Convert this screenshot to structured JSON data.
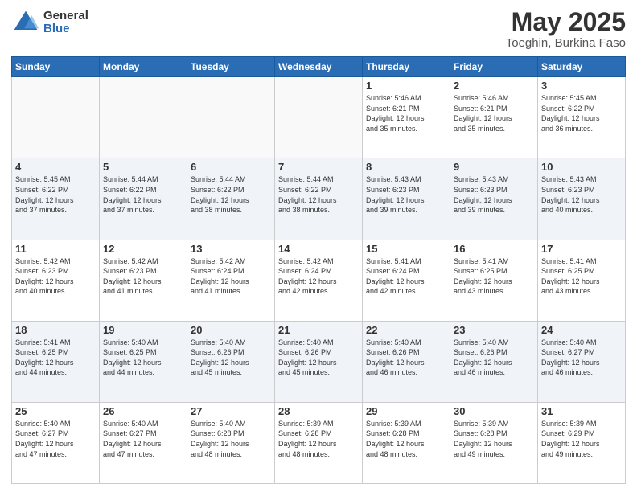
{
  "header": {
    "logo_general": "General",
    "logo_blue": "Blue",
    "title": "May 2025",
    "subtitle": "Toeghin, Burkina Faso"
  },
  "days_of_week": [
    "Sunday",
    "Monday",
    "Tuesday",
    "Wednesday",
    "Thursday",
    "Friday",
    "Saturday"
  ],
  "weeks": [
    [
      {
        "day": "",
        "info": ""
      },
      {
        "day": "",
        "info": ""
      },
      {
        "day": "",
        "info": ""
      },
      {
        "day": "",
        "info": ""
      },
      {
        "day": "1",
        "info": "Sunrise: 5:46 AM\nSunset: 6:21 PM\nDaylight: 12 hours\nand 35 minutes."
      },
      {
        "day": "2",
        "info": "Sunrise: 5:46 AM\nSunset: 6:21 PM\nDaylight: 12 hours\nand 35 minutes."
      },
      {
        "day": "3",
        "info": "Sunrise: 5:45 AM\nSunset: 6:22 PM\nDaylight: 12 hours\nand 36 minutes."
      }
    ],
    [
      {
        "day": "4",
        "info": "Sunrise: 5:45 AM\nSunset: 6:22 PM\nDaylight: 12 hours\nand 37 minutes."
      },
      {
        "day": "5",
        "info": "Sunrise: 5:44 AM\nSunset: 6:22 PM\nDaylight: 12 hours\nand 37 minutes."
      },
      {
        "day": "6",
        "info": "Sunrise: 5:44 AM\nSunset: 6:22 PM\nDaylight: 12 hours\nand 38 minutes."
      },
      {
        "day": "7",
        "info": "Sunrise: 5:44 AM\nSunset: 6:22 PM\nDaylight: 12 hours\nand 38 minutes."
      },
      {
        "day": "8",
        "info": "Sunrise: 5:43 AM\nSunset: 6:23 PM\nDaylight: 12 hours\nand 39 minutes."
      },
      {
        "day": "9",
        "info": "Sunrise: 5:43 AM\nSunset: 6:23 PM\nDaylight: 12 hours\nand 39 minutes."
      },
      {
        "day": "10",
        "info": "Sunrise: 5:43 AM\nSunset: 6:23 PM\nDaylight: 12 hours\nand 40 minutes."
      }
    ],
    [
      {
        "day": "11",
        "info": "Sunrise: 5:42 AM\nSunset: 6:23 PM\nDaylight: 12 hours\nand 40 minutes."
      },
      {
        "day": "12",
        "info": "Sunrise: 5:42 AM\nSunset: 6:23 PM\nDaylight: 12 hours\nand 41 minutes."
      },
      {
        "day": "13",
        "info": "Sunrise: 5:42 AM\nSunset: 6:24 PM\nDaylight: 12 hours\nand 41 minutes."
      },
      {
        "day": "14",
        "info": "Sunrise: 5:42 AM\nSunset: 6:24 PM\nDaylight: 12 hours\nand 42 minutes."
      },
      {
        "day": "15",
        "info": "Sunrise: 5:41 AM\nSunset: 6:24 PM\nDaylight: 12 hours\nand 42 minutes."
      },
      {
        "day": "16",
        "info": "Sunrise: 5:41 AM\nSunset: 6:25 PM\nDaylight: 12 hours\nand 43 minutes."
      },
      {
        "day": "17",
        "info": "Sunrise: 5:41 AM\nSunset: 6:25 PM\nDaylight: 12 hours\nand 43 minutes."
      }
    ],
    [
      {
        "day": "18",
        "info": "Sunrise: 5:41 AM\nSunset: 6:25 PM\nDaylight: 12 hours\nand 44 minutes."
      },
      {
        "day": "19",
        "info": "Sunrise: 5:40 AM\nSunset: 6:25 PM\nDaylight: 12 hours\nand 44 minutes."
      },
      {
        "day": "20",
        "info": "Sunrise: 5:40 AM\nSunset: 6:26 PM\nDaylight: 12 hours\nand 45 minutes."
      },
      {
        "day": "21",
        "info": "Sunrise: 5:40 AM\nSunset: 6:26 PM\nDaylight: 12 hours\nand 45 minutes."
      },
      {
        "day": "22",
        "info": "Sunrise: 5:40 AM\nSunset: 6:26 PM\nDaylight: 12 hours\nand 46 minutes."
      },
      {
        "day": "23",
        "info": "Sunrise: 5:40 AM\nSunset: 6:26 PM\nDaylight: 12 hours\nand 46 minutes."
      },
      {
        "day": "24",
        "info": "Sunrise: 5:40 AM\nSunset: 6:27 PM\nDaylight: 12 hours\nand 46 minutes."
      }
    ],
    [
      {
        "day": "25",
        "info": "Sunrise: 5:40 AM\nSunset: 6:27 PM\nDaylight: 12 hours\nand 47 minutes."
      },
      {
        "day": "26",
        "info": "Sunrise: 5:40 AM\nSunset: 6:27 PM\nDaylight: 12 hours\nand 47 minutes."
      },
      {
        "day": "27",
        "info": "Sunrise: 5:40 AM\nSunset: 6:28 PM\nDaylight: 12 hours\nand 48 minutes."
      },
      {
        "day": "28",
        "info": "Sunrise: 5:39 AM\nSunset: 6:28 PM\nDaylight: 12 hours\nand 48 minutes."
      },
      {
        "day": "29",
        "info": "Sunrise: 5:39 AM\nSunset: 6:28 PM\nDaylight: 12 hours\nand 48 minutes."
      },
      {
        "day": "30",
        "info": "Sunrise: 5:39 AM\nSunset: 6:28 PM\nDaylight: 12 hours\nand 49 minutes."
      },
      {
        "day": "31",
        "info": "Sunrise: 5:39 AM\nSunset: 6:29 PM\nDaylight: 12 hours\nand 49 minutes."
      }
    ]
  ]
}
